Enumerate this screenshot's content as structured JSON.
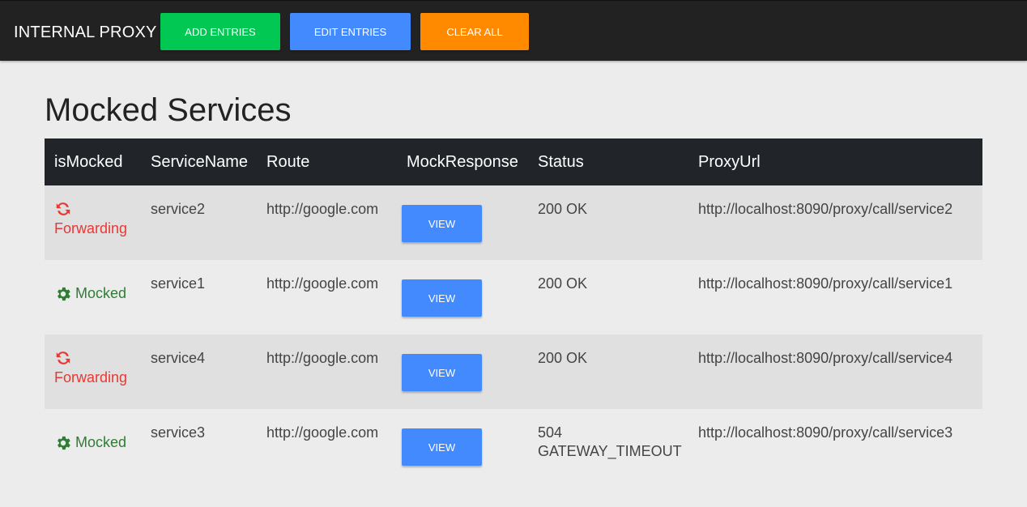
{
  "navbar": {
    "brand": "INTERNAL PROXY",
    "buttons": [
      {
        "label": "ADD ENTRIES",
        "color": "#00c853"
      },
      {
        "label": "EDIT ENTRIES",
        "color": "#448aff"
      },
      {
        "label": "CLEAR ALL",
        "color": "#ff8a00"
      }
    ]
  },
  "page": {
    "title": "Mocked Services"
  },
  "table": {
    "headers": [
      "isMocked",
      "ServiceName",
      "Route",
      "MockResponse",
      "Status",
      "ProxyUrl"
    ],
    "rows": [
      {
        "state": "Forwarding",
        "state_icon": "refresh-icon",
        "service": "service2",
        "route": "http://google.com",
        "mock_response": "VIEW",
        "status": "200 OK",
        "proxy_url": "http://localhost:8090/proxy/call/service2"
      },
      {
        "state": "Mocked",
        "state_icon": "gear-icon",
        "service": "service1",
        "route": "http://google.com",
        "mock_response": "VIEW",
        "status": "200 OK",
        "proxy_url": "http://localhost:8090/proxy/call/service1"
      },
      {
        "state": "Forwarding",
        "state_icon": "refresh-icon",
        "service": "service4",
        "route": "http://google.com",
        "mock_response": "VIEW",
        "status": "200 OK",
        "proxy_url": "http://localhost:8090/proxy/call/service4"
      },
      {
        "state": "Mocked",
        "state_icon": "gear-icon",
        "service": "service3",
        "route": "http://google.com",
        "mock_response": "VIEW",
        "status": "504 GATEWAY_TIMEOUT",
        "proxy_url": "http://localhost:8090/proxy/call/service3"
      }
    ]
  },
  "colors": {
    "forwarding": "#e53935",
    "mocked": "#2e7d32",
    "header_bg": "#212529",
    "view_button": "#448aff"
  }
}
